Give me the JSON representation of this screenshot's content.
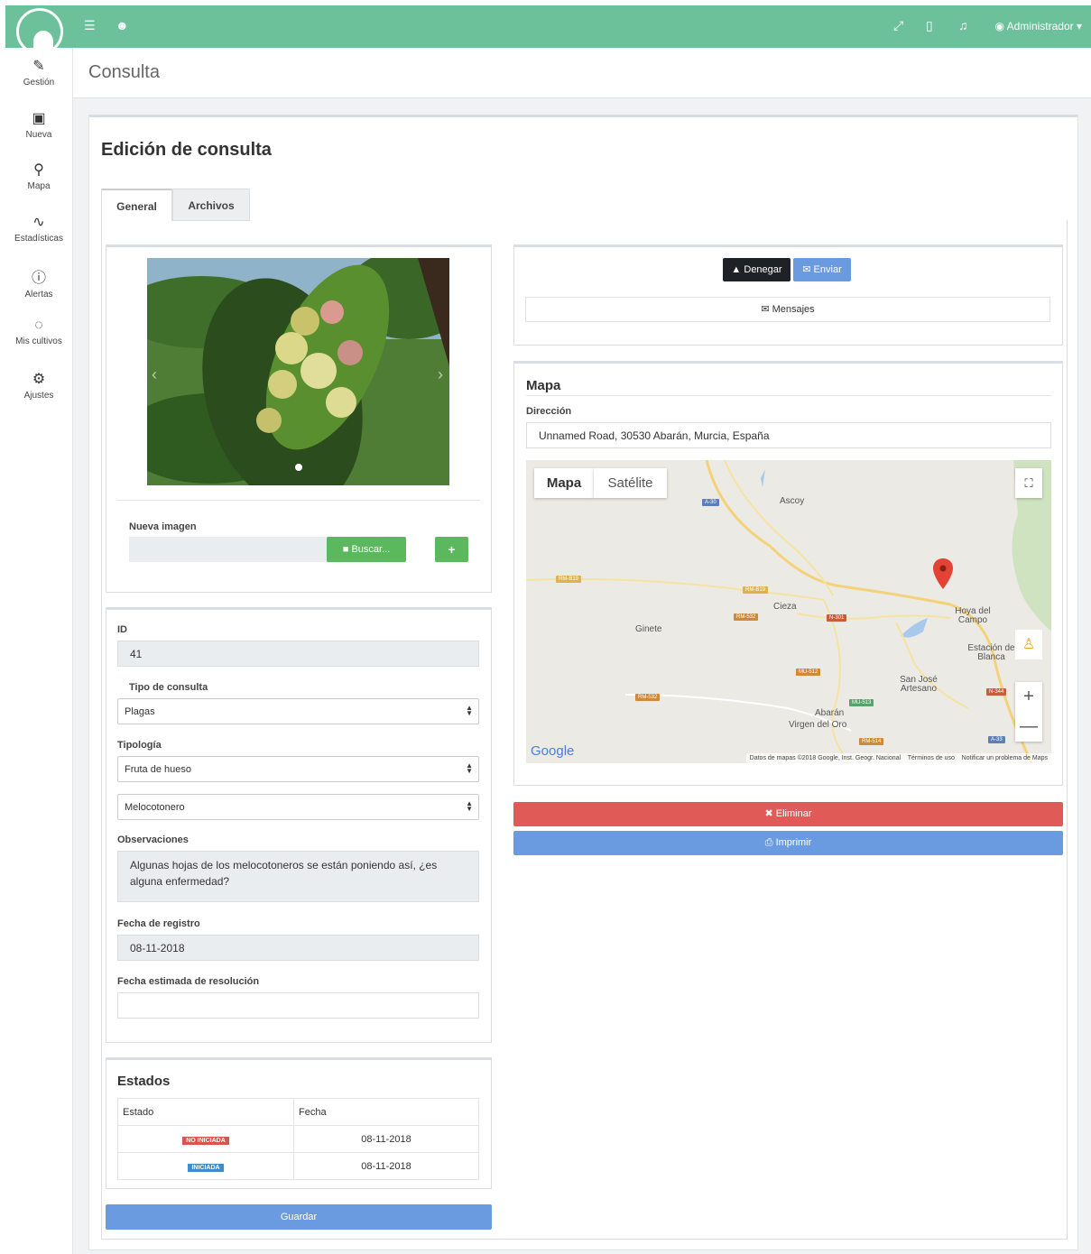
{
  "topbar": {
    "user": "Administrador"
  },
  "sidebar": {
    "items": [
      {
        "label": "Gestión",
        "icon": "wrench-icon"
      },
      {
        "label": "Nueva",
        "icon": "plus-square-icon"
      },
      {
        "label": "Mapa",
        "icon": "map-marker-icon"
      },
      {
        "label": "Estadísticas",
        "icon": "line-chart-icon"
      },
      {
        "label": "Alertas",
        "icon": "alert-circle-icon"
      },
      {
        "label": "Mis cultivos",
        "icon": "life-ring-icon"
      },
      {
        "label": "Ajustes",
        "icon": "gear-icon"
      }
    ]
  },
  "page": {
    "title": "Consulta",
    "card_title": "Edición de consulta",
    "tabs": [
      "General",
      "Archivos"
    ]
  },
  "image_panel": {
    "new_image_label": "Nueva imagen",
    "browse_button": "Buscar...",
    "add_button": "+"
  },
  "form": {
    "id_label": "ID",
    "id_value": "41",
    "tipo_label": "Tipo de consulta",
    "tipo_value": "Plagas",
    "tipologia_label": "Tipología",
    "tipologia_value": "Fruta de hueso",
    "subtipo_value": "Melocotonero",
    "observaciones_label": "Observaciones",
    "observaciones_value": "Algunas hojas de los melocotoneros se están poniendo así, ¿es alguna enfermedad?",
    "fecha_registro_label": "Fecha de registro",
    "fecha_registro_value": "08-11-2018",
    "fecha_resolucion_label": "Fecha estimada de resolución",
    "fecha_resolucion_value": ""
  },
  "estados": {
    "title": "Estados",
    "headers": [
      "Estado",
      "Fecha"
    ],
    "rows": [
      {
        "estado": "NO INICIADA",
        "fecha": "08-11-2018",
        "color": "#d9534f"
      },
      {
        "estado": "INICIADA",
        "fecha": "08-11-2018",
        "color": "#428bca"
      }
    ]
  },
  "save_button": "Guardar",
  "actions": {
    "deny": "Denegar",
    "send": "Enviar",
    "messages": "Mensajes",
    "delete": "Eliminar",
    "print": "Imprimir"
  },
  "map_panel": {
    "title": "Mapa",
    "address_label": "Dirección",
    "address_value": "Unnamed Road, 30530 Abarán, Murcia, España",
    "map_tabs": [
      "Mapa",
      "Satélite"
    ],
    "places": [
      "Ascoy",
      "Cieza",
      "Ginete",
      "Hoya del Campo",
      "Estación de Blanca",
      "San José Artesano",
      "Abarán",
      "Virgen del Oro"
    ],
    "roads": [
      "A-30",
      "RM-B19",
      "RM-B19",
      "RM-532",
      "N-301",
      "MU-512",
      "RM-532",
      "MU-513",
      "N-344",
      "RM-514",
      "A-33"
    ],
    "google": "Google",
    "footer": "Datos de mapas ©2018 Google, Inst. Geogr. Nacional",
    "terms": "Términos de uso",
    "report": "Notificar un problema de Maps"
  },
  "colors": {
    "green": "#6cc19a",
    "blue": "#6a9be0",
    "red": "#e05b57",
    "dark": "#1e2226"
  }
}
